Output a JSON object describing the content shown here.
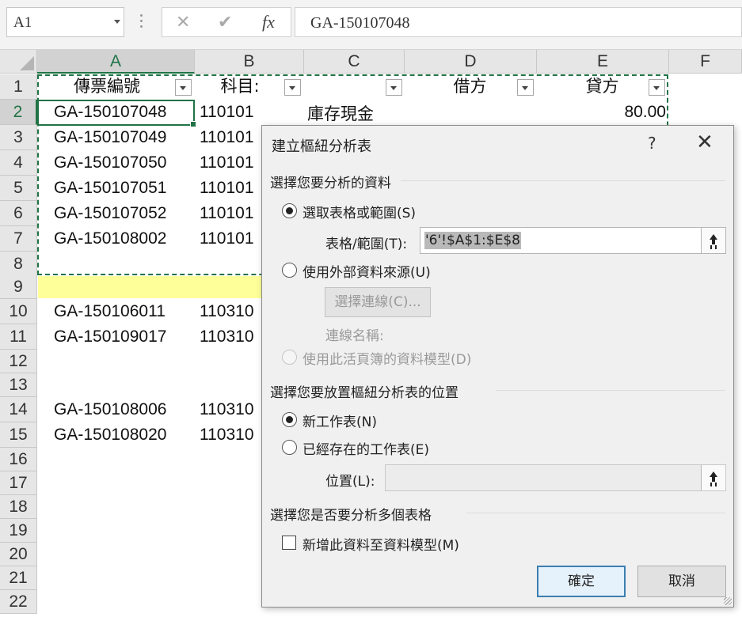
{
  "formula_bar": {
    "name_box": "A1",
    "cancel_icon": "✕",
    "enter_icon": "✔",
    "fx_label": "fx",
    "formula": "GA-150107048"
  },
  "columns": [
    "A",
    "B",
    "C",
    "D",
    "E",
    "F"
  ],
  "rows": [
    "1",
    "2",
    "3",
    "4",
    "5",
    "6",
    "7",
    "8",
    "9",
    "10",
    "11",
    "12",
    "13",
    "14",
    "15",
    "16",
    "17",
    "18",
    "19",
    "20",
    "21",
    "22"
  ],
  "header_row": {
    "a": "傳票編號",
    "b": "科目:",
    "d": "借方",
    "e": "貸方"
  },
  "cells": {
    "a2": "GA-150107048",
    "b2": "110101",
    "c2": "庫存現金",
    "e2": "80.00",
    "a3": "GA-150107049",
    "b3": "110101",
    "a4": "GA-150107050",
    "b4": "110101",
    "a5": "GA-150107051",
    "b5": "110101",
    "a6": "GA-150107052",
    "b6": "110101",
    "a7": "GA-150108002",
    "b7": "110101",
    "a10": "GA-150106011",
    "b10": "110310",
    "a11": "GA-150109017",
    "b11": "110310",
    "a14": "GA-150108006",
    "b14": "110310",
    "a15": "GA-150108020",
    "b15": "110310"
  },
  "colors": {
    "accent": "#217346",
    "highlight_row": "#ffff99",
    "default_button_border": "#3c7fb1"
  },
  "dialog": {
    "title": "建立樞紐分析表",
    "help": "?",
    "close": "✕",
    "section_data": "選擇您要分析的資料",
    "opt_table_range": "選取表格或範圍(S)",
    "range_label": "表格/範圍(T):",
    "range_value": "'6'!$A$1:$E$8",
    "opt_external": "使用外部資料來源(U)",
    "choose_connection": "選擇連線(C)...",
    "connection_name": "連線名稱:",
    "opt_data_model": "使用此活頁簿的資料模型(D)",
    "section_location": "選擇您要放置樞紐分析表的位置",
    "opt_new_sheet": "新工作表(N)",
    "opt_existing_sheet": "已經存在的工作表(E)",
    "location_label": "位置(L):",
    "location_value": "",
    "section_multi": "選擇您是否要分析多個表格",
    "add_to_model": "新增此資料至資料模型(M)",
    "ok": "確定",
    "cancel": "取消"
  }
}
